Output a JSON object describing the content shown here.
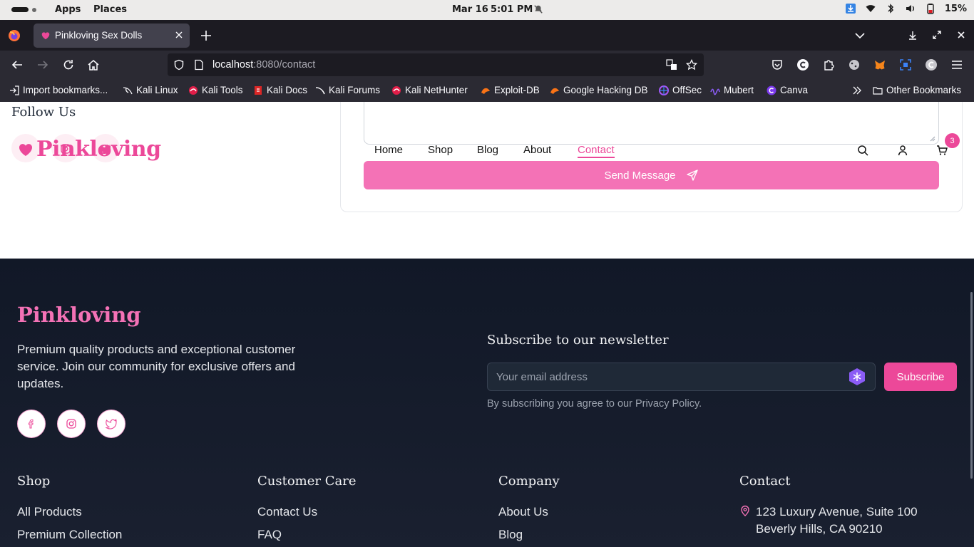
{
  "os": {
    "apps": "Apps",
    "places": "Places",
    "date": "Mar 16",
    "time": "5:01 PM",
    "battery": "15%"
  },
  "browser": {
    "tab_title": "Pinkloving Sex Dolls",
    "url_host": "localhost",
    "url_path": ":8080/contact"
  },
  "bookmarks": [
    {
      "label": "Import bookmarks...",
      "icon": "import-icon"
    },
    {
      "label": "Kali Linux",
      "icon": "kali-icon"
    },
    {
      "label": "Kali Tools",
      "icon": "kali-tools-icon"
    },
    {
      "label": "Kali Docs",
      "icon": "kali-docs-icon"
    },
    {
      "label": "Kali Forums",
      "icon": "kali-forums-icon"
    },
    {
      "label": "Kali NetHunter",
      "icon": "nethunter-icon"
    },
    {
      "label": "Exploit-DB",
      "icon": "exploit-db-icon"
    },
    {
      "label": "Google Hacking DB",
      "icon": "ghdb-icon"
    },
    {
      "label": "OffSec",
      "icon": "offsec-icon"
    },
    {
      "label": "Mubert",
      "icon": "mubert-icon"
    },
    {
      "label": "Canva",
      "icon": "canva-icon"
    }
  ],
  "bookmarks_other": "Other Bookmarks",
  "page": {
    "follow_title": "Follow Us",
    "brand_name": "Pinkloving",
    "nav": [
      "Home",
      "Shop",
      "Blog",
      "About",
      "Contact"
    ],
    "active_nav": "Contact",
    "cart_count": "3",
    "send_label": "Send Message"
  },
  "footer": {
    "brand": "Pinkloving",
    "description": "Premium quality products and exceptional customer service. Join our community for exclusive offers and updates.",
    "newsletter_title": "Subscribe to our newsletter",
    "email_placeholder": "Your email address",
    "subscribe_label": "Subscribe",
    "newsletter_note": "By subscribing you agree to our Privacy Policy.",
    "columns": [
      {
        "title": "Shop",
        "links": [
          "All Products",
          "Premium Collection"
        ]
      },
      {
        "title": "Customer Care",
        "links": [
          "Contact Us",
          "FAQ"
        ]
      },
      {
        "title": "Company",
        "links": [
          "About Us",
          "Blog"
        ]
      },
      {
        "title": "Contact",
        "links": [
          "123 Luxury Avenue, Suite 100",
          "Beverly Hills, CA 90210"
        ]
      }
    ]
  },
  "colors": {
    "brand_pink": "#ec4899",
    "button_pink": "#f472b6",
    "footer_bg": "#111827"
  }
}
